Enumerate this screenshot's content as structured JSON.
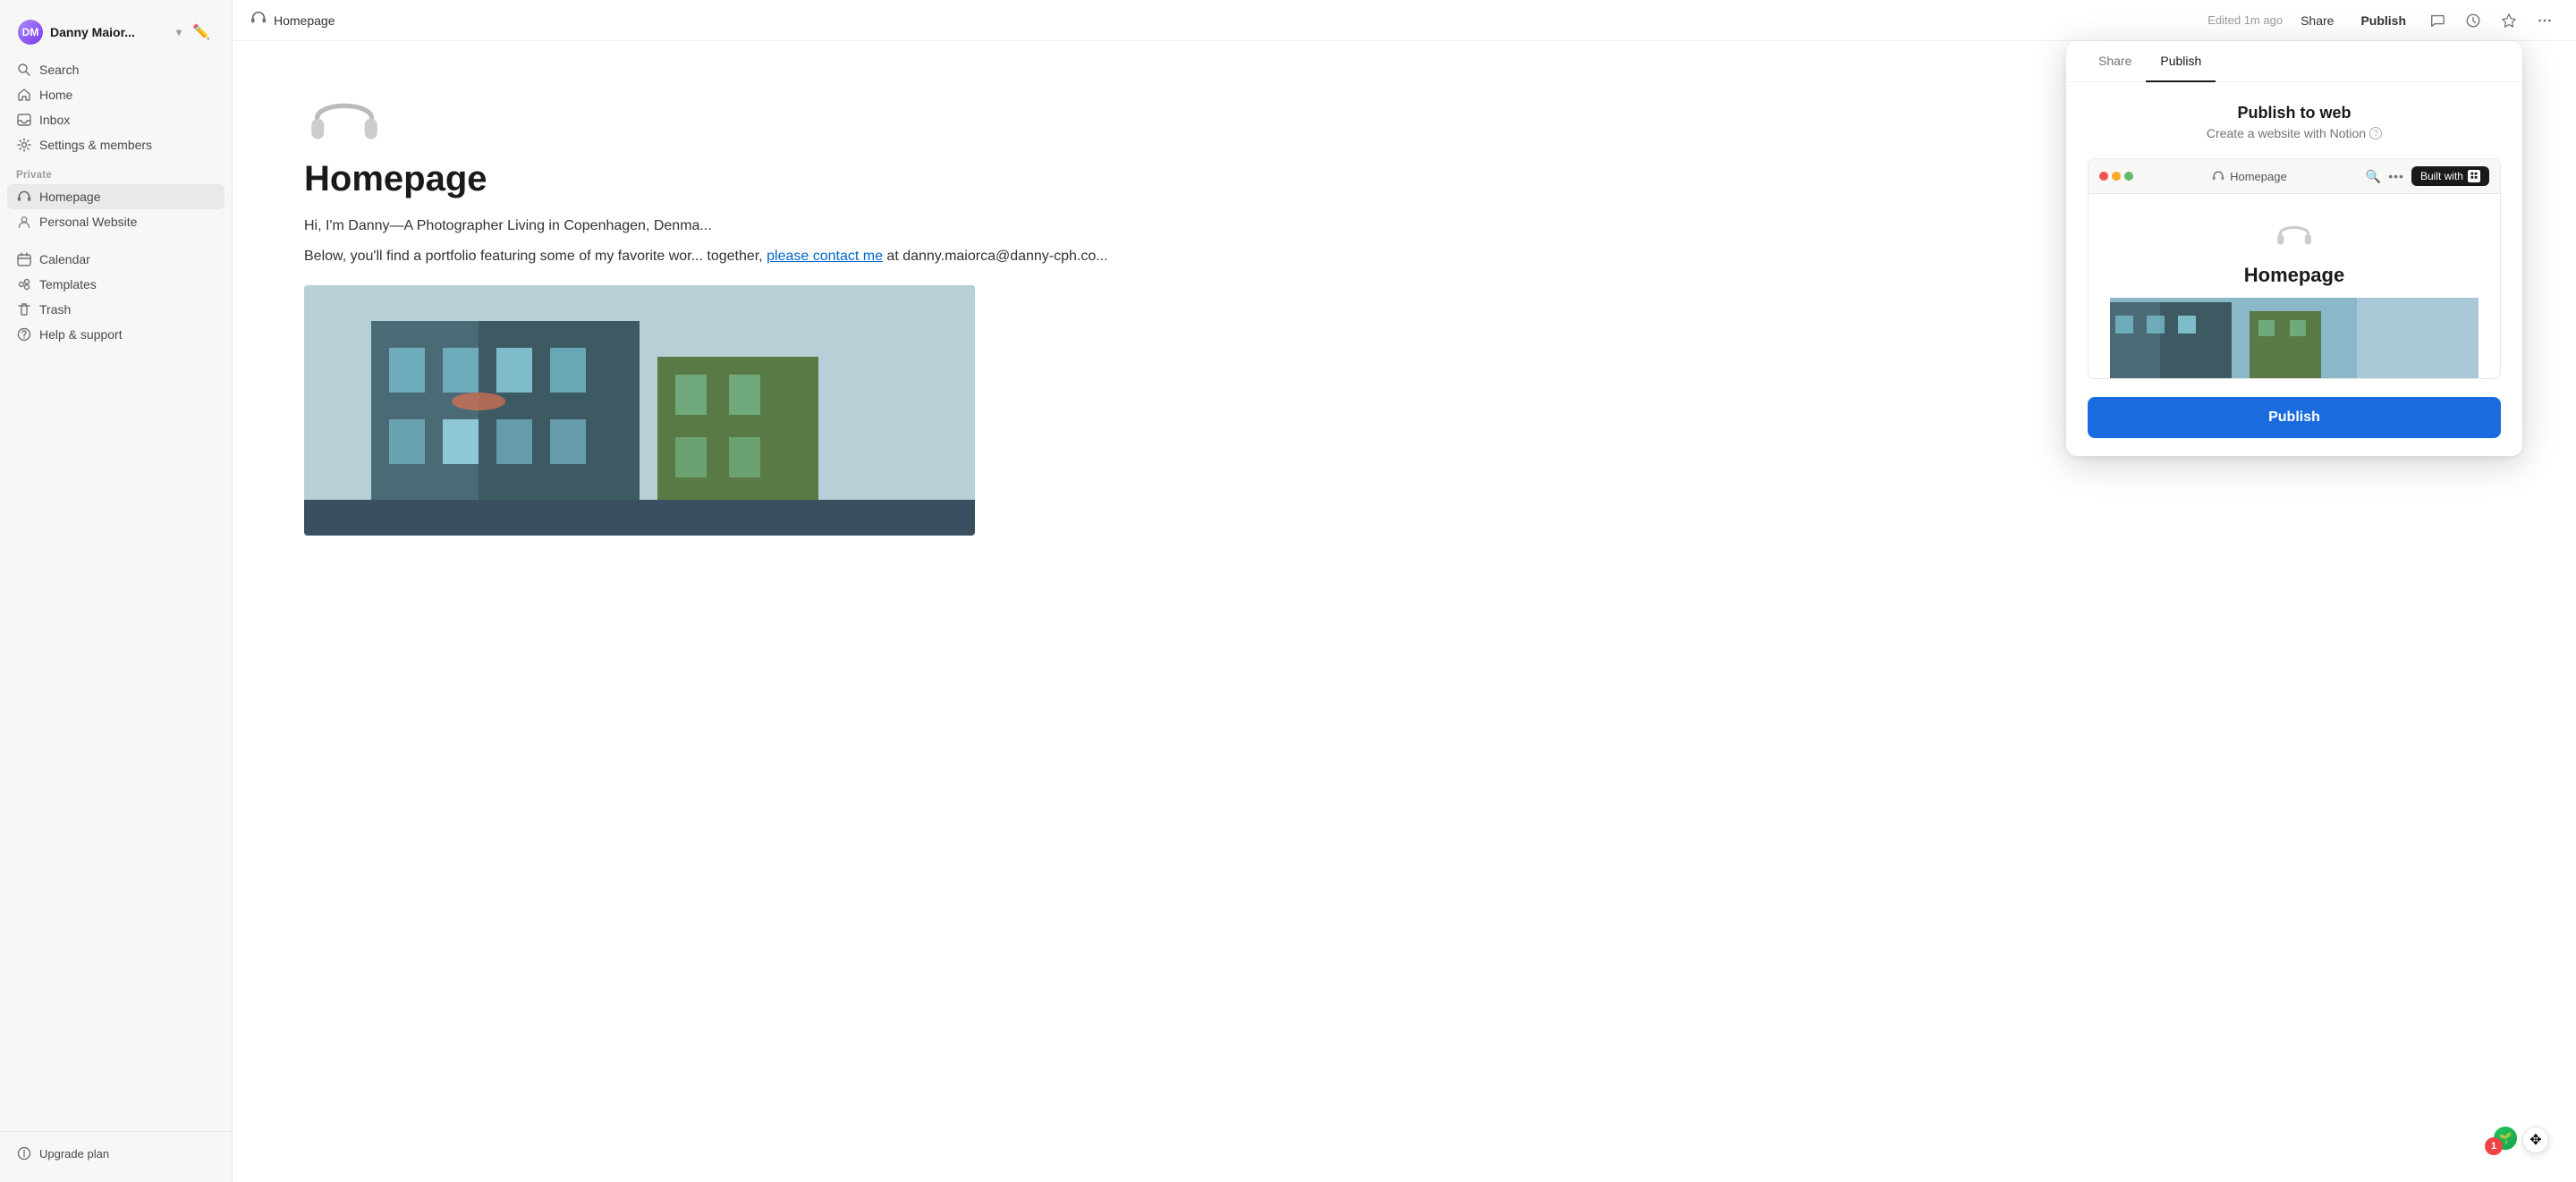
{
  "sidebar": {
    "user": {
      "name": "Danny Maior...",
      "avatar_initials": "DM"
    },
    "nav_items": [
      {
        "id": "search",
        "label": "Search",
        "icon": "🔍"
      },
      {
        "id": "home",
        "label": "Home",
        "icon": "🏠"
      },
      {
        "id": "inbox",
        "label": "Inbox",
        "icon": "📥"
      },
      {
        "id": "settings",
        "label": "Settings & members",
        "icon": "⚙️"
      }
    ],
    "section_label": "Private",
    "pages": [
      {
        "id": "homepage",
        "label": "Homepage",
        "icon": "🎧",
        "active": true
      },
      {
        "id": "personal-website",
        "label": "Personal Website",
        "icon": "👤"
      }
    ],
    "bottom_items": [
      {
        "id": "calendar",
        "label": "Calendar",
        "icon": "📅"
      },
      {
        "id": "templates",
        "label": "Templates",
        "icon": "👥"
      },
      {
        "id": "trash",
        "label": "Trash",
        "icon": "🗑️"
      },
      {
        "id": "help",
        "label": "Help & support",
        "icon": "ℹ️"
      }
    ],
    "upgrade_label": "Upgrade plan"
  },
  "topbar": {
    "page_title": "Homepage",
    "page_icon": "🎧",
    "edited_text": "Edited 1m ago",
    "share_label": "Share",
    "publish_label": "Publish"
  },
  "page": {
    "title": "Homepage",
    "subtitle": "Hi, I'm Danny—A Photographer Living in Copenhagen, Denma...",
    "body_text": "Below, you'll find a portfolio featuring some of my favorite wor... together,",
    "link_text": "please contact me",
    "body_suffix": " at danny.maiorca@danny-cph.co..."
  },
  "publish_modal": {
    "tab_share": "Share",
    "tab_publish": "Publish",
    "title": "Publish to web",
    "subtitle": "Create a website with Notion",
    "preview": {
      "page_label": "Homepage",
      "built_with_text": "Built with",
      "built_with_icon": "N",
      "preview_title": "Homepage",
      "search_icon": "🔍",
      "dots_icon": "···"
    },
    "publish_button": "Publish"
  },
  "floating": {
    "avatar_icon": "🌱",
    "badge_count": "1",
    "move_icon": "✥"
  },
  "colors": {
    "accent_blue": "#1a6cde",
    "sidebar_bg": "#f7f7f5",
    "active_bg": "#e9e9e7",
    "dot_red": "#ef5350",
    "dot_yellow": "#ffa726",
    "dot_green": "#66bb6a"
  }
}
